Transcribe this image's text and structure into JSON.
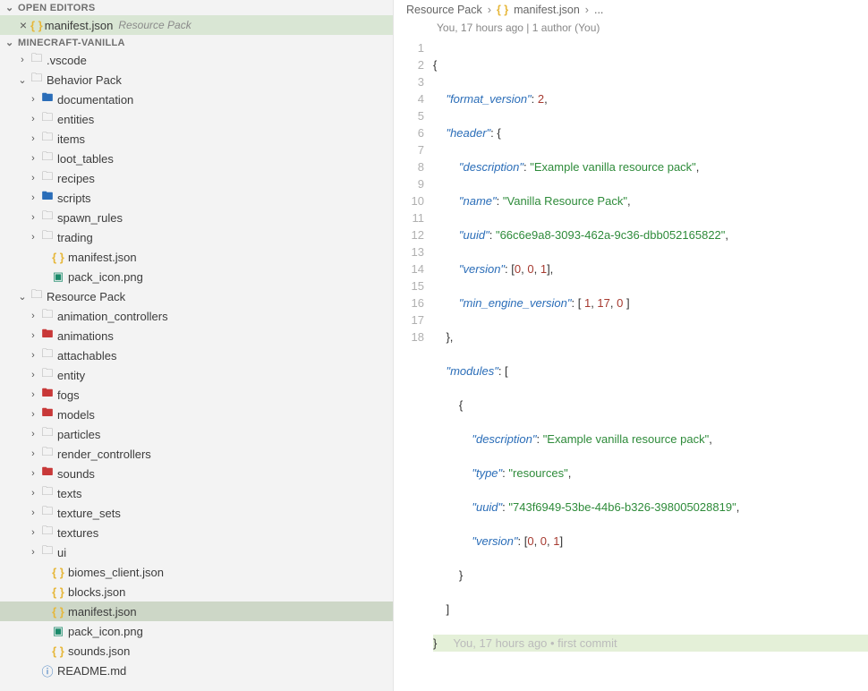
{
  "sections": {
    "openEditors": "OPEN EDITORS",
    "workspace": "MINECRAFT-VANILLA"
  },
  "openEditor": {
    "label": "manifest.json",
    "hint": "Resource Pack"
  },
  "tree": {
    "vscode": ".vscode",
    "behaviorPack": "Behavior Pack",
    "bp": {
      "documentation": "documentation",
      "entities": "entities",
      "items": "items",
      "loot_tables": "loot_tables",
      "recipes": "recipes",
      "scripts": "scripts",
      "spawn_rules": "spawn_rules",
      "trading": "trading",
      "manifest": "manifest.json",
      "pack_icon": "pack_icon.png"
    },
    "resourcePack": "Resource Pack",
    "rp": {
      "animation_controllers": "animation_controllers",
      "animations": "animations",
      "attachables": "attachables",
      "entity": "entity",
      "fogs": "fogs",
      "models": "models",
      "particles": "particles",
      "render_controllers": "render_controllers",
      "sounds": "sounds",
      "texts": "texts",
      "texture_sets": "texture_sets",
      "textures": "textures",
      "ui": "ui",
      "biomes_client": "biomes_client.json",
      "blocks": "blocks.json",
      "manifest": "manifest.json",
      "pack_icon": "pack_icon.png",
      "sounds_json": "sounds.json"
    },
    "readme": "README.md"
  },
  "breadcrumb": {
    "p0": "Resource Pack",
    "p1": "manifest.json",
    "p2": "..."
  },
  "gitlens": "You, 17 hours ago | 1 author (You)",
  "code": {
    "l1": "{",
    "l2a": "\"format_version\"",
    "l2b": "2",
    "l3a": "\"header\"",
    "l4a": "\"description\"",
    "l4b": "\"Example vanilla resource pack\"",
    "l5a": "\"name\"",
    "l5b": "\"Vanilla Resource Pack\"",
    "l6a": "\"uuid\"",
    "l6b": "\"66c6e9a8-3093-462a-9c36-dbb052165822\"",
    "l7a": "\"version\"",
    "l7b": "0",
    "l7c": "0",
    "l7d": "1",
    "l8a": "\"min_engine_version\"",
    "l8b": "1",
    "l8c": "17",
    "l8d": "0",
    "l10a": "\"modules\"",
    "l12a": "\"description\"",
    "l12b": "\"Example vanilla resource pack\"",
    "l13a": "\"type\"",
    "l13b": "\"resources\"",
    "l14a": "\"uuid\"",
    "l14b": "\"743f6949-53be-44b6-b326-398005028819\"",
    "l15a": "\"version\"",
    "l15b": "0",
    "l15c": "0",
    "l15d": "1",
    "inlinegl": "You, 17 hours ago • first commit"
  },
  "lineNumbers": [
    "1",
    "2",
    "3",
    "4",
    "5",
    "6",
    "7",
    "8",
    "9",
    "10",
    "11",
    "12",
    "13",
    "14",
    "15",
    "16",
    "17",
    "18"
  ]
}
